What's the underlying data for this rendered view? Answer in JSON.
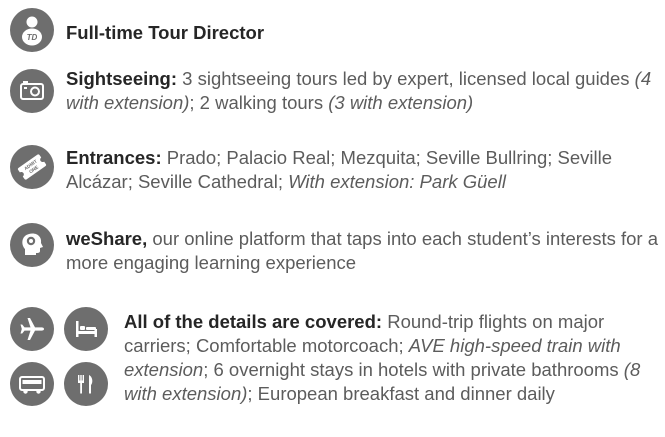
{
  "colors": {
    "icon_bg": "#6e6e6e",
    "heading": "#262626",
    "body": "#5c5c5c"
  },
  "items": [
    {
      "icon": "tour-director-icon",
      "icon_text": "TD",
      "title": "Full-time Tour Director"
    },
    {
      "icon": "camera-icon",
      "title": "Sightseeing:",
      "t1": " 3 sightseeing tours led by expert, licensed local guides ",
      "t2": "(4 with extension)",
      "t3": "; 2 walking tours ",
      "t4": "(3 with extension)"
    },
    {
      "icon": "ticket-icon",
      "icon_text": "ADMIT ONE",
      "title": "Entrances:",
      "t1": " Prado; Palacio Real; Mezquita; Seville Bullring; Seville Alcázar; Seville Cathedral; ",
      "t2": "With extension: Park Güell"
    },
    {
      "icon": "head-brain-icon",
      "title": "weShare,",
      "t1": " our online platform that taps into each student’s interests for a more engaging learning experience"
    },
    {
      "icons": [
        "airplane-icon",
        "bed-icon",
        "bus-icon",
        "utensils-icon"
      ],
      "title": "All of the details are covered:",
      "t1": " Round-trip flights on major carriers; Comfortable motorcoach; ",
      "t2": "AVE high-speed train with extension",
      "t3": "; 6 overnight stays in hotels with private bathrooms ",
      "t4": "(8 with extension)",
      "t5": "; European breakfast and dinner daily"
    }
  ]
}
